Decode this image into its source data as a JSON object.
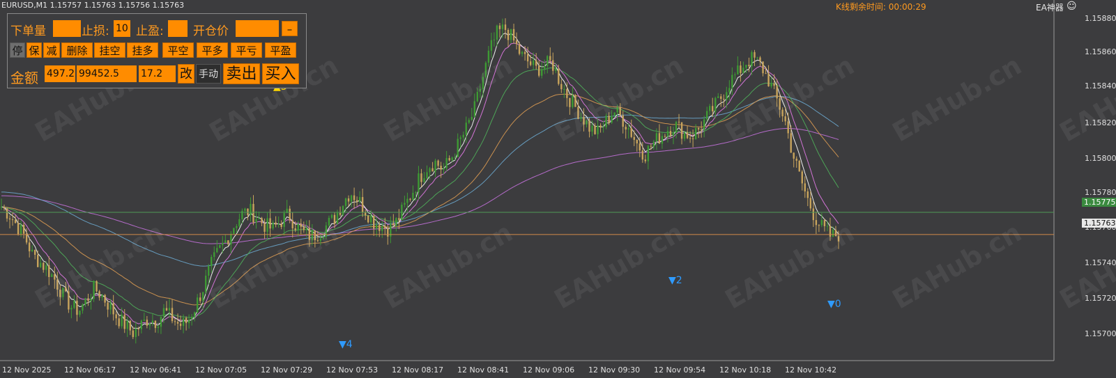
{
  "header": {
    "title": "EURUSD,M1  1.15757 1.15763 1.15756 1.15763",
    "countdown": "K线剩余时间: 00:00:29",
    "ea_label": "EA神器",
    "smiley_icon": "smiley-icon"
  },
  "watermark": "EAHub.cn",
  "panel": {
    "row1": {
      "lot_label": "下单量",
      "lot_value": "",
      "sl_label": "止损:",
      "sl_value": "10",
      "tp_label": "止盈:",
      "tp_value": "",
      "open_price_label": "开仓价",
      "open_price_value": "",
      "minimize_label": "–"
    },
    "row2": [
      "停",
      "保",
      "减",
      "删除",
      "挂空",
      "挂多",
      "平空",
      "平多",
      "平亏",
      "平盈"
    ],
    "row3": {
      "amount_label": "金额",
      "value1": "497.2",
      "value2": "99452.5",
      "value3": "17.2",
      "modify_label": "改",
      "mode_label": "手动",
      "sell_label": "卖出",
      "buy_label": "买入"
    }
  },
  "price_axis": [
    "1.15880",
    "1.15860",
    "1.15840",
    "1.15820",
    "1.15800",
    "1.15780",
    "1.15760",
    "1.15740",
    "1.15720",
    "1.15700"
  ],
  "price_tags": {
    "green_line": "1.15775",
    "current_price": "1.15763"
  },
  "time_axis": [
    "12 Nov 2025",
    "12 Nov 06:17",
    "12 Nov 06:41",
    "12 Nov 07:05",
    "12 Nov 07:29",
    "12 Nov 07:53",
    "12 Nov 08:17",
    "12 Nov 08:41",
    "12 Nov 09:06",
    "12 Nov 09:30",
    "12 Nov 09:54",
    "12 Nov 10:18",
    "12 Nov 10:42"
  ],
  "signals": [
    {
      "label": "▲5",
      "color": "#ffd700"
    },
    {
      "label": "▼2",
      "color": "#2f9bff"
    },
    {
      "label": "▼4",
      "color": "#2f9bff"
    },
    {
      "label": "▼0",
      "color": "#2f9bff"
    }
  ],
  "colors": {
    "bull": "#3e9a34",
    "bear": "#c8a45c",
    "ma_fast": "#ffffff",
    "ma_magenta": "#e27ae6",
    "ma_green": "#4fae5a",
    "ma_orange": "#d99a52",
    "ma_blue": "#6aa6cc",
    "ma_violet": "#c170d8"
  },
  "chart_data": {
    "type": "candlestick",
    "symbol": "EURUSD",
    "timeframe": "M1",
    "ylim": [
      1.15695,
      1.15885
    ],
    "close_path": [
      1.15778,
      1.15774,
      1.15768,
      1.15762,
      1.15752,
      1.15748,
      1.15744,
      1.15738,
      1.1573,
      1.15724,
      1.15722,
      1.15728,
      1.15734,
      1.1573,
      1.15724,
      1.15718,
      1.15714,
      1.1571,
      1.15714,
      1.15718,
      1.15716,
      1.15722,
      1.15718,
      1.15714,
      1.15716,
      1.15724,
      1.15734,
      1.15746,
      1.15754,
      1.1576,
      1.15768,
      1.15774,
      1.15776,
      1.15772,
      1.15768,
      1.15766,
      1.1577,
      1.15774,
      1.15768,
      1.15764,
      1.15762,
      1.15764,
      1.15768,
      1.15772,
      1.1578,
      1.15786,
      1.15782,
      1.15776,
      1.1577,
      1.15768,
      1.15766,
      1.1577,
      1.15778,
      1.15786,
      1.15794,
      1.158,
      1.15802,
      1.15798,
      1.15804,
      1.15812,
      1.1582,
      1.1583,
      1.15846,
      1.15862,
      1.15872,
      1.15874,
      1.15868,
      1.1586,
      1.15856,
      1.15852,
      1.15854,
      1.15856,
      1.15846,
      1.15838,
      1.15832,
      1.15826,
      1.1582,
      1.15818,
      1.15824,
      1.1583,
      1.15826,
      1.1582,
      1.15812,
      1.15806,
      1.15812,
      1.15816,
      1.1582,
      1.15822,
      1.15818,
      1.15816,
      1.1582,
      1.15826,
      1.15832,
      1.15838,
      1.15846,
      1.1585,
      1.15856,
      1.15858,
      1.15854,
      1.15846,
      1.15836,
      1.15826,
      1.15808,
      1.15794,
      1.15782,
      1.15772,
      1.15766,
      1.15762,
      1.15763
    ],
    "ma_periods": [
      5,
      10,
      25,
      50,
      100,
      200
    ],
    "horizontal_lines": [
      1.15775,
      1.15763
    ]
  }
}
